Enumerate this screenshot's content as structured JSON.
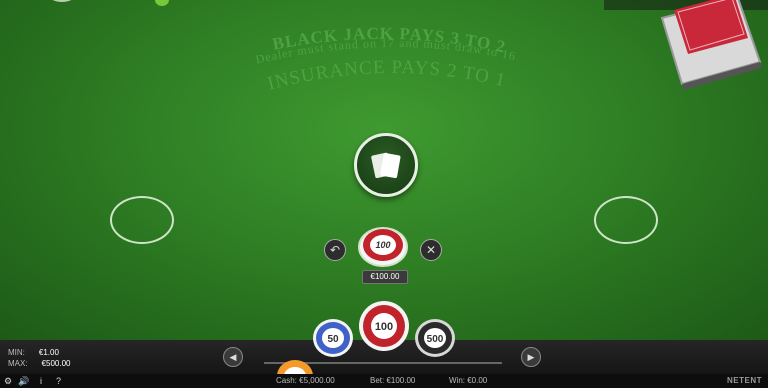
{
  "table": {
    "line1": "BLACK JACK PAYS 3 TO 2",
    "line2": "Dealer must stand on 17 and must draw to 16",
    "line3": "INSURANCE PAYS 2 TO 1",
    "felt_color": "#2f7f24"
  },
  "bet": {
    "chip_value": "100",
    "amount": "€100.00",
    "undo_icon": "undo-icon",
    "clear_icon": "close-icon"
  },
  "chips": [
    {
      "value": "50",
      "color": "#3f62c9"
    },
    {
      "value": "100",
      "color": "#c0232a"
    },
    {
      "value": "500",
      "color": "#2a2a2a"
    }
  ],
  "limits": {
    "min_label": "MIN:",
    "min_value": "€1.00",
    "max_label": "MAX:",
    "max_value": "€500.00"
  },
  "footer": {
    "cash": "Cash: €5,000.00",
    "bet": "Bet: €100.00",
    "win": "Win: €0.00",
    "brand": "NETENT",
    "settings_icon": "wrench-icon",
    "sound_icon": "speaker-icon",
    "info_icon": "i",
    "help_icon": "?"
  }
}
